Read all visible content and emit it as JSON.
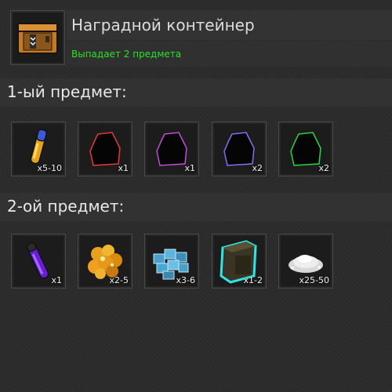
{
  "header": {
    "title": "Наградной контейнер",
    "subtitle": "Выпадает 2 предмета",
    "subtitle_color": "#27e327",
    "icon": "reward-container-icon"
  },
  "sections": [
    {
      "label": "1-ый предмет:",
      "items": [
        {
          "icon": "yellow-vial-icon",
          "qty": "x5-10"
        },
        {
          "icon": "red-outline-bag-icon",
          "qty": "x1",
          "color": "#e23a3a"
        },
        {
          "icon": "magenta-outline-bag-icon",
          "qty": "x1",
          "color": "#c04cd8"
        },
        {
          "icon": "violet-outline-bag-icon",
          "qty": "x2",
          "color": "#8a6cf0"
        },
        {
          "icon": "green-outline-bag-icon",
          "qty": "x2",
          "color": "#2ed43a"
        }
      ]
    },
    {
      "label": "2-ой предмет:",
      "items": [
        {
          "icon": "purple-vial-icon",
          "qty": "x1"
        },
        {
          "icon": "orange-crystals-icon",
          "qty": "x2-5"
        },
        {
          "icon": "blue-cubes-icon",
          "qty": "x3-6"
        },
        {
          "icon": "glowing-case-icon",
          "qty": "x1-2"
        },
        {
          "icon": "white-powder-icon",
          "qty": "x25-50"
        }
      ]
    }
  ]
}
